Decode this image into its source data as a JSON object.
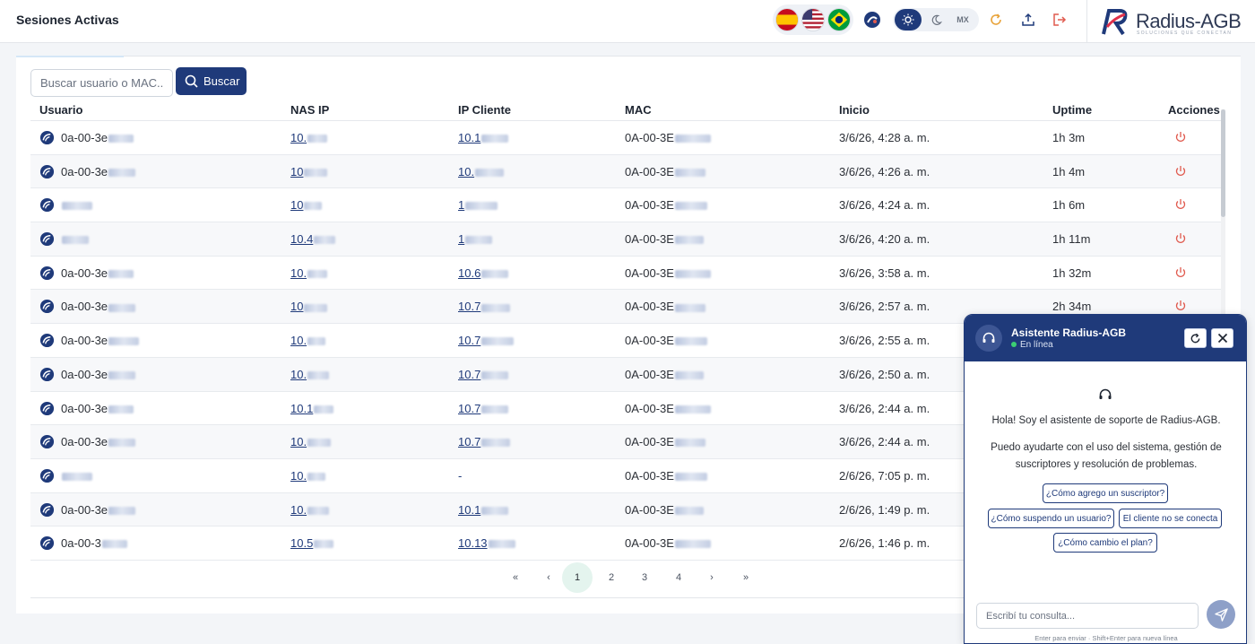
{
  "header": {
    "title": "Sesiones Activas",
    "region_label": "MX",
    "logo_text": "Radius-AGB",
    "logo_tagline": "SOLUCIONES QUE CONECTAN"
  },
  "search": {
    "placeholder": "Buscar usuario o MAC...",
    "button_label": "Buscar"
  },
  "table": {
    "columns": [
      "Usuario",
      "NAS IP",
      "IP Cliente",
      "MAC",
      "Inicio",
      "Uptime",
      "Acciones"
    ],
    "rows": [
      {
        "usuario": "0a-00-3e",
        "nas_ip": "10.",
        "ip_cliente": "10.1",
        "mac": "0A-00-3E",
        "inicio": "3/6/26, 4:28 a. m.",
        "uptime": "1h 3m"
      },
      {
        "usuario": "0a-00-3e",
        "nas_ip": "10",
        "ip_cliente": "10.",
        "mac": "0A-00-3E",
        "inicio": "3/6/26, 4:26 a. m.",
        "uptime": "1h 4m"
      },
      {
        "usuario": "",
        "nas_ip": "10",
        "ip_cliente": "1",
        "mac": "0A-00-3E",
        "inicio": "3/6/26, 4:24 a. m.",
        "uptime": "1h 6m"
      },
      {
        "usuario": "",
        "nas_ip": "10.4",
        "ip_cliente": "1",
        "mac": "0A-00-3E",
        "inicio": "3/6/26, 4:20 a. m.",
        "uptime": "1h 11m"
      },
      {
        "usuario": "0a-00-3e",
        "nas_ip": "10.",
        "ip_cliente": "10.6",
        "mac": "0A-00-3E",
        "inicio": "3/6/26, 3:58 a. m.",
        "uptime": "1h 32m"
      },
      {
        "usuario": "0a-00-3e",
        "nas_ip": "10",
        "ip_cliente": "10.7",
        "mac": "0A-00-3E",
        "inicio": "3/6/26, 2:57 a. m.",
        "uptime": "2h 34m"
      },
      {
        "usuario": "0a-00-3e",
        "nas_ip": "10.",
        "ip_cliente": "10.7",
        "mac": "0A-00-3E",
        "inicio": "3/6/26, 2:55 a. m.",
        "uptime": ""
      },
      {
        "usuario": "0a-00-3e",
        "nas_ip": "10.",
        "ip_cliente": "10.7",
        "mac": "0A-00-3E",
        "inicio": "3/6/26, 2:50 a. m.",
        "uptime": ""
      },
      {
        "usuario": "0a-00-3e",
        "nas_ip": "10.1",
        "ip_cliente": "10.7",
        "mac": "0A-00-3E",
        "inicio": "3/6/26, 2:44 a. m.",
        "uptime": ""
      },
      {
        "usuario": "0a-00-3e",
        "nas_ip": "10.",
        "ip_cliente": "10.7",
        "mac": "0A-00-3E",
        "inicio": "3/6/26, 2:44 a. m.",
        "uptime": ""
      },
      {
        "usuario": "",
        "nas_ip": "10.",
        "ip_cliente": "-",
        "mac": "0A-00-3E",
        "inicio": "2/6/26, 7:05 p. m.",
        "uptime": ""
      },
      {
        "usuario": "0a-00-3e",
        "nas_ip": "10.",
        "ip_cliente": "10.1",
        "mac": "0A-00-3E",
        "inicio": "2/6/26, 1:49 p. m.",
        "uptime": ""
      },
      {
        "usuario": "0a-00-3",
        "nas_ip": "10.5",
        "ip_cliente": "10.13",
        "mac": "0A-00-3E",
        "inicio": "2/6/26, 1:46 p. m.",
        "uptime": ""
      }
    ]
  },
  "pagination": {
    "first": "«",
    "prev": "‹",
    "pages": [
      "1",
      "2",
      "3",
      "4"
    ],
    "current": "1",
    "next": "›",
    "last": "»"
  },
  "chat": {
    "title": "Asistente Radius-AGB",
    "status": "En línea",
    "greeting": "Hola! Soy el asistente de soporte de Radius-AGB.",
    "intro": "Puedo ayudarte con el uso del sistema, gestión de suscriptores y resolución de problemas.",
    "suggestions": [
      "¿Cómo agrego un suscriptor?",
      "¿Cómo suspendo un usuario?",
      "El cliente no se conecta",
      "¿Cómo cambio el plan?"
    ],
    "input_placeholder": "Escribí tu consulta...",
    "hint": "Enter para enviar · Shift+Enter para nueva línea"
  },
  "colors": {
    "brand": "#1f3a7a",
    "power": "#e05a4e",
    "online": "#3ccf73"
  },
  "icons": {
    "user": "wifi-user-icon",
    "action": "power-icon",
    "search": "search-icon",
    "chat": "headset-icon"
  }
}
